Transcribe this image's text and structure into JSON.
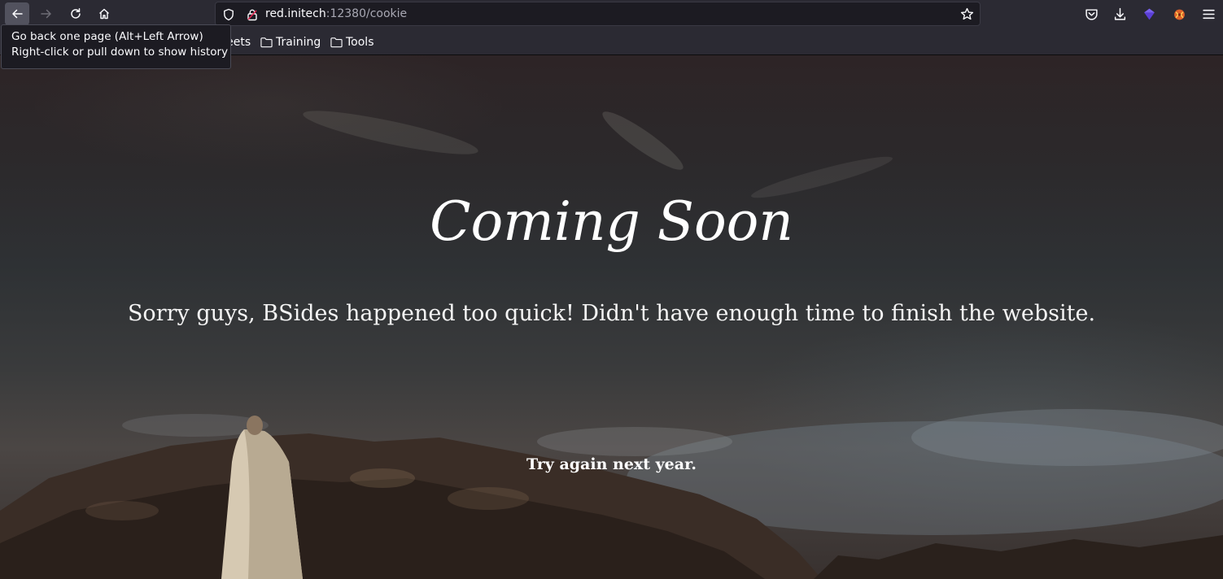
{
  "browser": {
    "url_host": "red.initech",
    "url_rest": ":12380/cookie",
    "bookmarks": [
      {
        "label": "heat sheets"
      },
      {
        "label": "Training"
      },
      {
        "label": "Tools"
      }
    ],
    "tooltip": {
      "line1": "Go back one page (Alt+Left Arrow)",
      "line2": "Right-click or pull down to show history"
    },
    "icons": [
      "back-arrow-icon",
      "forward-arrow-icon",
      "reload-icon",
      "home-icon",
      "shield-icon",
      "lock-icon",
      "star-icon",
      "pocket-icon",
      "download-icon",
      "extension-icon",
      "extension-icon",
      "menu-icon"
    ]
  },
  "page": {
    "title": "Coming Soon",
    "message": "Sorry guys, BSides happened too quick! Didn't have enough time to finish the website.",
    "footer": "Try again next year."
  },
  "colors": {
    "chrome": "#2b2a33",
    "urlbar": "#1c1b22",
    "text": "#fbfbfe"
  }
}
